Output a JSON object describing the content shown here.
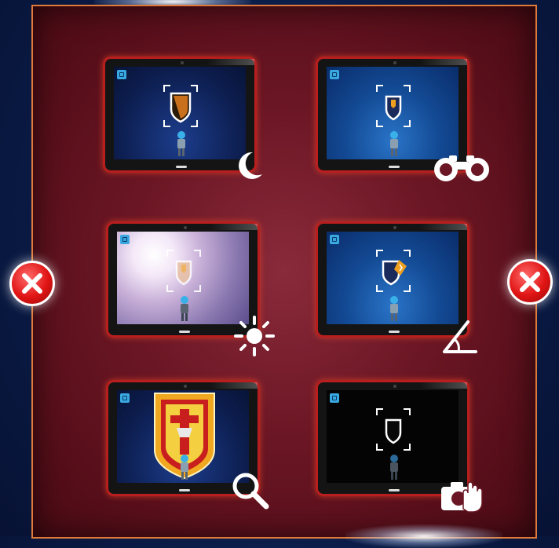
{
  "screen": {
    "description_free": true,
    "tiles": [
      {
        "id": "night",
        "icon": "moon-icon"
      },
      {
        "id": "distance",
        "icon": "binoculars-icon"
      },
      {
        "id": "bright-light",
        "icon": "sun-icon"
      },
      {
        "id": "angle",
        "icon": "angle-icon"
      },
      {
        "id": "too-close",
        "icon": "magnifier-icon"
      },
      {
        "id": "covered-camera",
        "icon": "hand-camera-icon"
      }
    ],
    "left_button_icon": "close-icon",
    "right_button_icon": "close-icon"
  },
  "colors": {
    "panel_border": "#e07a3a",
    "tablet_border": "#b81e1e",
    "close_button": "#e01414"
  }
}
